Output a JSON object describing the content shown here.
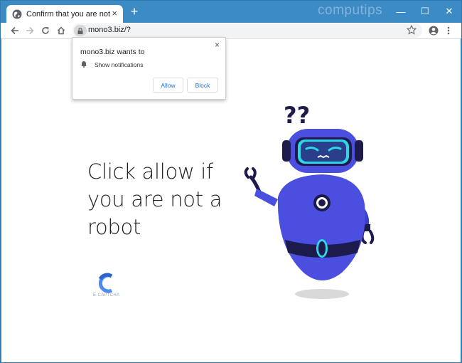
{
  "browser": {
    "tab": {
      "title": "Confirm that you are not a robot",
      "close_glyph": "×"
    },
    "new_tab_glyph": "+",
    "watermark": "computips",
    "window_controls": {
      "minimize": "—",
      "maximize": "☐",
      "close": "✕"
    },
    "toolbar": {
      "url": "mono3.biz/?"
    }
  },
  "permission_popup": {
    "title": "mono3.biz wants to",
    "permission": "Show notifications",
    "allow_label": "Allow",
    "block_label": "Block",
    "close_glyph": "×"
  },
  "page": {
    "headline_lines": [
      "Click allow if",
      "you are not a",
      "robot"
    ],
    "captcha_logo_text": "E-CAPTCHA"
  },
  "colors": {
    "titlebar": "#3d8bc5",
    "robot_body": "#4a4fe0",
    "robot_dark": "#1d1b4c",
    "visor": "#2dd6e8",
    "button_text": "#1a73e8"
  }
}
